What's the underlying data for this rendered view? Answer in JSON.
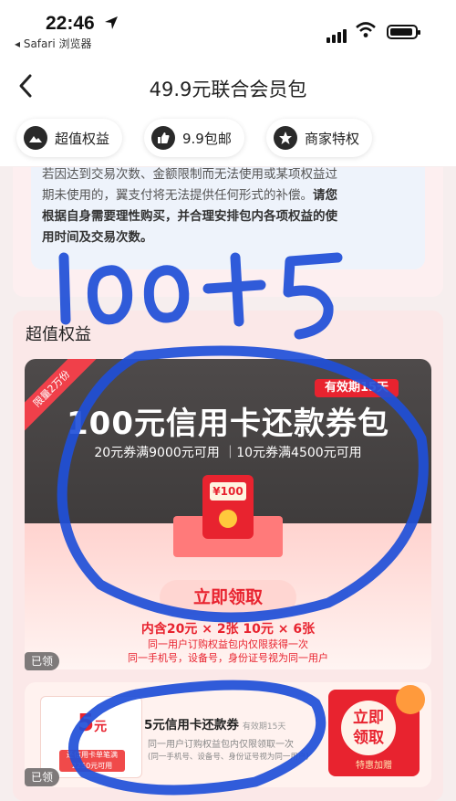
{
  "status": {
    "time": "22:46",
    "back_app": "◂ Safari 浏览器"
  },
  "nav": {
    "title": "49.9元联合会员包"
  },
  "chips": [
    {
      "label": "超值权益",
      "icon": "image-icon"
    },
    {
      "label": "9.9包邮",
      "icon": "thumbs-up-icon"
    },
    {
      "label": "商家特权",
      "icon": "star-icon"
    }
  ],
  "notice": {
    "line1": "若因达到交易次数、金额限制而无法使用或某项权益过",
    "line2": "期未使用的，翼支付将无法提供任何形式的补偿。",
    "line2_bold": "请您",
    "line3_bold": "根据自身需要理性购买，并合理安排包内各项权益的使",
    "line4_bold": "用时间及交易次数。"
  },
  "section": {
    "title": "超值权益"
  },
  "big_coupon": {
    "ribbon": "限量2万份",
    "validity": "有效期15天",
    "title": "100元信用卡还款券包",
    "subtitle": "20元券满9000元可用 ｜10元券满4500元可用",
    "envelope_amount": "¥100",
    "claim_label": "立即领取",
    "contains": "内含20元 × 2张  10元 × 6张",
    "note1": "同一用户订购权益包内仅限获得一次",
    "note2": "同一手机号，设备号，身份证号视为同一用户",
    "claimed_label": "已领"
  },
  "small_coupon": {
    "value": "5",
    "unit": "元",
    "condition": "还信用卡单笔满2250元可用",
    "title": "5元信用卡还款券",
    "validity": "有效期15天",
    "note1": "同一用户订购权益包内仅限领取一次",
    "note2": "(同一手机号、设备号、身份证号视为同一用户)",
    "claim_label_1": "立即",
    "claim_label_2": "领取",
    "tag": "特惠加赠",
    "claimed_label": "已领"
  },
  "handwriting": {
    "text": "100+5"
  }
}
